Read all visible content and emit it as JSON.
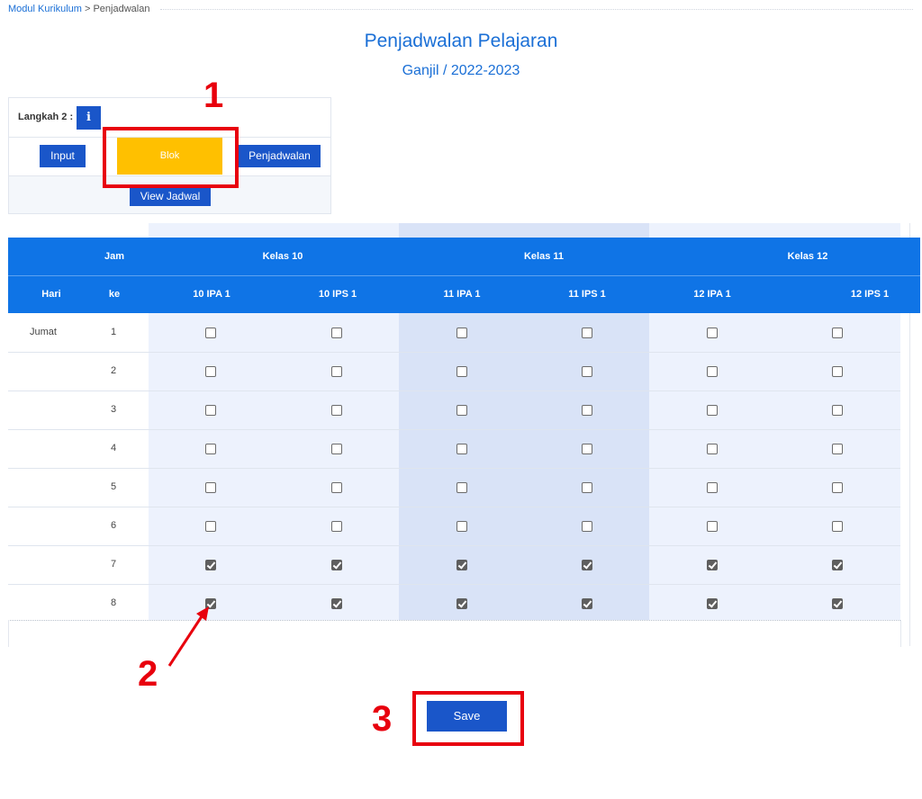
{
  "breadcrumb": {
    "link": "Modul Kurikulum",
    "separator": " > ",
    "current": "Penjadwalan"
  },
  "header": {
    "title": "Penjadwalan Pelajaran",
    "subtitle": "Ganjil / 2022-2023"
  },
  "step_panel": {
    "label": "Langkah 2 :",
    "info_icon": "info-icon",
    "info_glyph": "i",
    "buttons": {
      "input": "Input",
      "blok": "Blok",
      "penjadwalan": "Penjadwalan",
      "view": "View Jadwal"
    }
  },
  "table": {
    "header_row1": {
      "jam": "Jam",
      "groups": [
        "Kelas 10",
        "Kelas 11",
        "Kelas 12"
      ]
    },
    "header_row2": {
      "hari": "Hari",
      "ke": "ke",
      "classes": [
        "10 IPA 1",
        "10 IPS 1",
        "11 IPA 1",
        "11 IPS 1",
        "12 IPA 1",
        "12 IPS 1"
      ]
    },
    "rows": [
      {
        "hari": "Jumat",
        "jam": "1",
        "checked": [
          false,
          false,
          false,
          false,
          false,
          false
        ]
      },
      {
        "hari": "",
        "jam": "2",
        "checked": [
          false,
          false,
          false,
          false,
          false,
          false
        ]
      },
      {
        "hari": "",
        "jam": "3",
        "checked": [
          false,
          false,
          false,
          false,
          false,
          false
        ]
      },
      {
        "hari": "",
        "jam": "4",
        "checked": [
          false,
          false,
          false,
          false,
          false,
          false
        ]
      },
      {
        "hari": "",
        "jam": "5",
        "checked": [
          false,
          false,
          false,
          false,
          false,
          false
        ]
      },
      {
        "hari": "",
        "jam": "6",
        "checked": [
          false,
          false,
          false,
          false,
          false,
          false
        ]
      },
      {
        "hari": "",
        "jam": "7",
        "checked": [
          true,
          true,
          true,
          true,
          true,
          true
        ]
      },
      {
        "hari": "",
        "jam": "8",
        "checked": [
          true,
          true,
          true,
          true,
          true,
          true
        ]
      }
    ]
  },
  "save_label": "Save",
  "annotations": {
    "one": "1",
    "two": "2",
    "three": "3",
    "color": "#e8000d"
  },
  "colors": {
    "primary": "#1a56c9",
    "header": "#0f74e6",
    "blok": "#ffc000",
    "title": "#1a6fd6"
  }
}
